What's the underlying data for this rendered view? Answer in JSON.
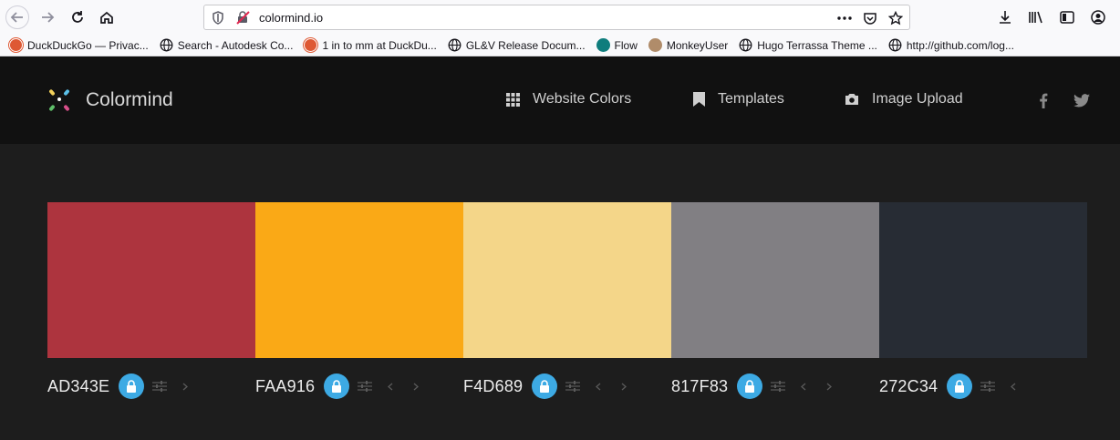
{
  "browser": {
    "url": "colormind.io",
    "bookmarks": [
      {
        "label": "DuckDuckGo — Privac...",
        "icon": "duckduckgo-icon"
      },
      {
        "label": "Search - Autodesk Co...",
        "icon": "globe-icon"
      },
      {
        "label": "1 in to mm at DuckDu...",
        "icon": "duckduckgo-icon"
      },
      {
        "label": "GL&V Release Docum...",
        "icon": "globe-icon"
      },
      {
        "label": "Flow",
        "icon": "flow-icon"
      },
      {
        "label": "MonkeyUser",
        "icon": "monkeyuser-icon"
      },
      {
        "label": "Hugo Terrassa Theme ...",
        "icon": "globe-icon"
      },
      {
        "label": "http://github.com/log...",
        "icon": "globe-icon"
      }
    ]
  },
  "site": {
    "logo_text": "Colormind",
    "nav": [
      {
        "label": "Website Colors",
        "icon": "grid-icon"
      },
      {
        "label": "Templates",
        "icon": "bookmark-icon"
      },
      {
        "label": "Image Upload",
        "icon": "camera-icon"
      }
    ],
    "social": [
      "facebook-icon",
      "twitter-icon"
    ]
  },
  "palette": [
    {
      "hex": "AD343E",
      "color": "#AD343E",
      "arrows": [
        "right"
      ]
    },
    {
      "hex": "FAA916",
      "color": "#FAA916",
      "arrows": [
        "left",
        "right"
      ]
    },
    {
      "hex": "F4D689",
      "color": "#F4D689",
      "arrows": [
        "left",
        "right"
      ]
    },
    {
      "hex": "817F83",
      "color": "#817F83",
      "arrows": [
        "left",
        "right"
      ]
    },
    {
      "hex": "272C34",
      "color": "#272C34",
      "arrows": [
        "left"
      ]
    }
  ],
  "colors": {
    "lock_accent": "#3daae4",
    "header_bg": "#111111",
    "page_bg": "#1d1d1d"
  }
}
